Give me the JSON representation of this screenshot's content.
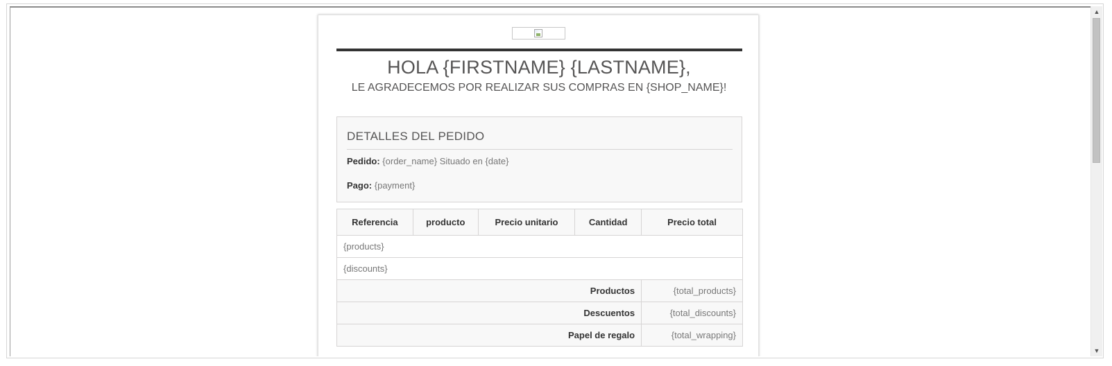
{
  "email": {
    "greeting": "HOLA {FIRSTNAME} {LASTNAME},",
    "thanks": "LE AGRADECEMOS POR REALIZAR SUS COMPRAS EN {SHOP_NAME}!"
  },
  "details": {
    "title": "DETALLES DEL PEDIDO",
    "order_label": "Pedido:",
    "order_value": "{order_name} Situado en {date}",
    "payment_label": "Pago:",
    "payment_value": "{payment}"
  },
  "table": {
    "headers": [
      "Referencia",
      "producto",
      "Precio unitario",
      "Cantidad",
      "Precio total"
    ],
    "rows": [
      "{products}",
      "{discounts}"
    ],
    "totals": [
      {
        "label": "Productos",
        "value": "{total_products}"
      },
      {
        "label": "Descuentos",
        "value": "{total_discounts}"
      },
      {
        "label": "Papel de regalo",
        "value": "{total_wrapping}"
      }
    ]
  },
  "icons": {
    "logo": "broken-image-icon",
    "scroll_up": "arrow-up-icon",
    "scroll_down": "arrow-down-icon"
  }
}
